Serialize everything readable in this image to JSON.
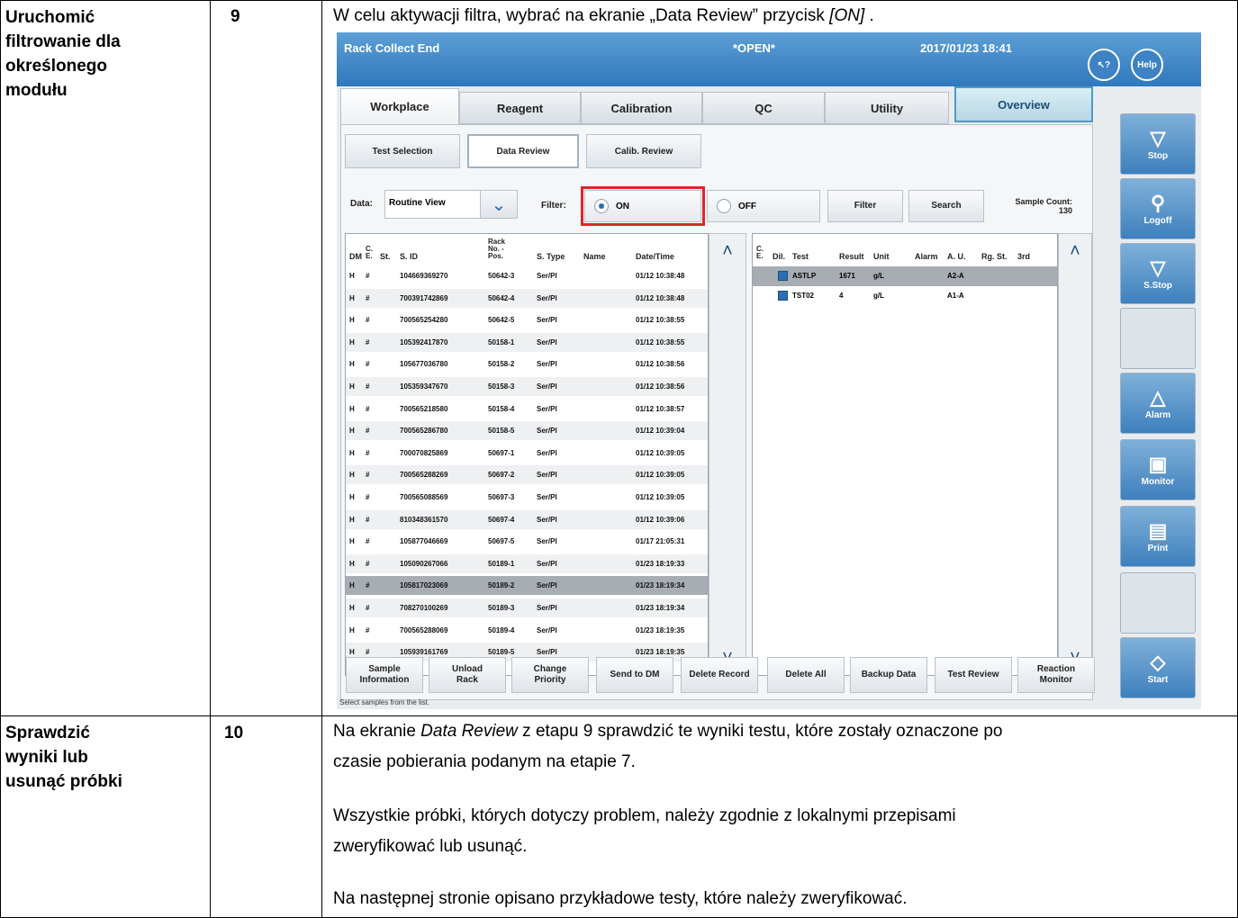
{
  "doc": {
    "row1": {
      "title_lines": [
        "Uruchomić",
        "filtrowanie dla",
        "określonego",
        "modułu"
      ],
      "step": "9",
      "instruction_pre": "W celu aktywacji filtra, wybrać na ekranie „Data Review” przycisk ",
      "instruction_em": "[ON]",
      "instruction_post": " ."
    },
    "row2": {
      "title_lines": [
        "Sprawdzić",
        "wyniki lub",
        "usunąć próbki"
      ],
      "step": "10",
      "p1_pre": "Na ekranie ",
      "p1_em": "Data Review",
      "p1_post": " z etapu 9 sprawdzić te wyniki testu, które zostały oznaczone po",
      "p1_line2": "czasie pobierania podanym na etapie 7.",
      "p2_line1": "Wszystkie próbki, których dotyczy problem, należy zgodnie z lokalnymi przepisami",
      "p2_line2": "zweryfikować lub usunąć.",
      "p3": "Na następnej stronie opisano przykładowe testy, które należy zweryfikować."
    }
  },
  "screen": {
    "title_left": "Rack Collect End",
    "title_mid": "*OPEN*",
    "datetime": "2017/01/23   18:41",
    "help_label": "Help",
    "cursor_help_label": "↖?",
    "tabs": [
      "Workplace",
      "Reagent",
      "Calibration",
      "QC",
      "Utility",
      "Overview"
    ],
    "subtabs": [
      "Test Selection",
      "Data Review",
      "Calib. Review"
    ],
    "data_label": "Data:",
    "data_value": "Routine View",
    "filter_label": "Filter:",
    "on_label": "ON",
    "off_label": "OFF",
    "filter_btn": "Filter",
    "search_btn": "Search",
    "sample_count_label": "Sample Count:",
    "sample_count": "130",
    "left_headers": [
      "DM",
      "C.\nE.",
      "St.",
      "S. ID",
      "Rack\nNo. -\nPos.",
      "S. Type",
      "Name",
      "Date/Time"
    ],
    "rows": [
      [
        "H",
        "#",
        "104669369270",
        "50642-3",
        "Ser/Pl",
        "01/12 10:38:48"
      ],
      [
        "H",
        "#",
        "700391742869",
        "50642-4",
        "Ser/Pl",
        "01/12 10:38:48"
      ],
      [
        "H",
        "#",
        "700565254280",
        "50642-5",
        "Ser/Pl",
        "01/12 10:38:55"
      ],
      [
        "H",
        "#",
        "105392417870",
        "50158-1",
        "Ser/Pl",
        "01/12 10:38:55"
      ],
      [
        "H",
        "#",
        "105677036780",
        "50158-2",
        "Ser/Pl",
        "01/12 10:38:56"
      ],
      [
        "H",
        "#",
        "105359347670",
        "50158-3",
        "Ser/Pl",
        "01/12 10:38:56"
      ],
      [
        "H",
        "#",
        "700565218580",
        "50158-4",
        "Ser/Pl",
        "01/12 10:38:57"
      ],
      [
        "H",
        "#",
        "700565286780",
        "50158-5",
        "Ser/Pl",
        "01/12 10:39:04"
      ],
      [
        "H",
        "#",
        "700070825869",
        "50697-1",
        "Ser/Pl",
        "01/12 10:39:05"
      ],
      [
        "H",
        "#",
        "700565288269",
        "50697-2",
        "Ser/Pl",
        "01/12 10:39:05"
      ],
      [
        "H",
        "#",
        "700565088569",
        "50697-3",
        "Ser/Pl",
        "01/12 10:39:05"
      ],
      [
        "H",
        "#",
        "810348361570",
        "50697-4",
        "Ser/Pl",
        "01/12 10:39:06"
      ],
      [
        "H",
        "#",
        "105877046669",
        "50697-5",
        "Ser/Pl",
        "01/17 21:05:31"
      ],
      [
        "H",
        "#",
        "105090267066",
        "50189-1",
        "Ser/Pl",
        "01/23 18:19:33"
      ],
      [
        "H",
        "#",
        "105817023069",
        "50189-2",
        "Ser/Pl",
        "01/23 18:19:34"
      ],
      [
        "H",
        "#",
        "708270100269",
        "50189-3",
        "Ser/Pl",
        "01/23 18:19:34"
      ],
      [
        "H",
        "#",
        "700565288069",
        "50189-4",
        "Ser/Pl",
        "01/23 18:19:35"
      ],
      [
        "H",
        "#",
        "105939161769",
        "50189-5",
        "Ser/Pl",
        "01/23 18:19:35"
      ]
    ],
    "selected_row": 14,
    "right_headers": [
      "C.\nE.",
      "Dil.",
      "Test",
      "Result",
      "Unit",
      "Alarm",
      "A. U.",
      "Rg. St.",
      "3rd"
    ],
    "results": [
      [
        "ASTLP",
        "1671",
        "g/L",
        "A2-A"
      ],
      [
        "TST02",
        "4",
        "g/L",
        "A1-A"
      ]
    ],
    "bottom_buttons": [
      "Sample\nInformation",
      "Unload\nRack",
      "Change\nPriority",
      "Send to DM",
      "Delete Record",
      "Delete All",
      "Backup Data",
      "Test Review",
      "Reaction\nMonitor"
    ],
    "side_buttons": [
      "Stop",
      "Logoff",
      "S.Stop",
      "",
      "Alarm",
      "Monitor",
      "Print",
      "",
      "Start"
    ],
    "status_text": "Select samples from the list."
  }
}
